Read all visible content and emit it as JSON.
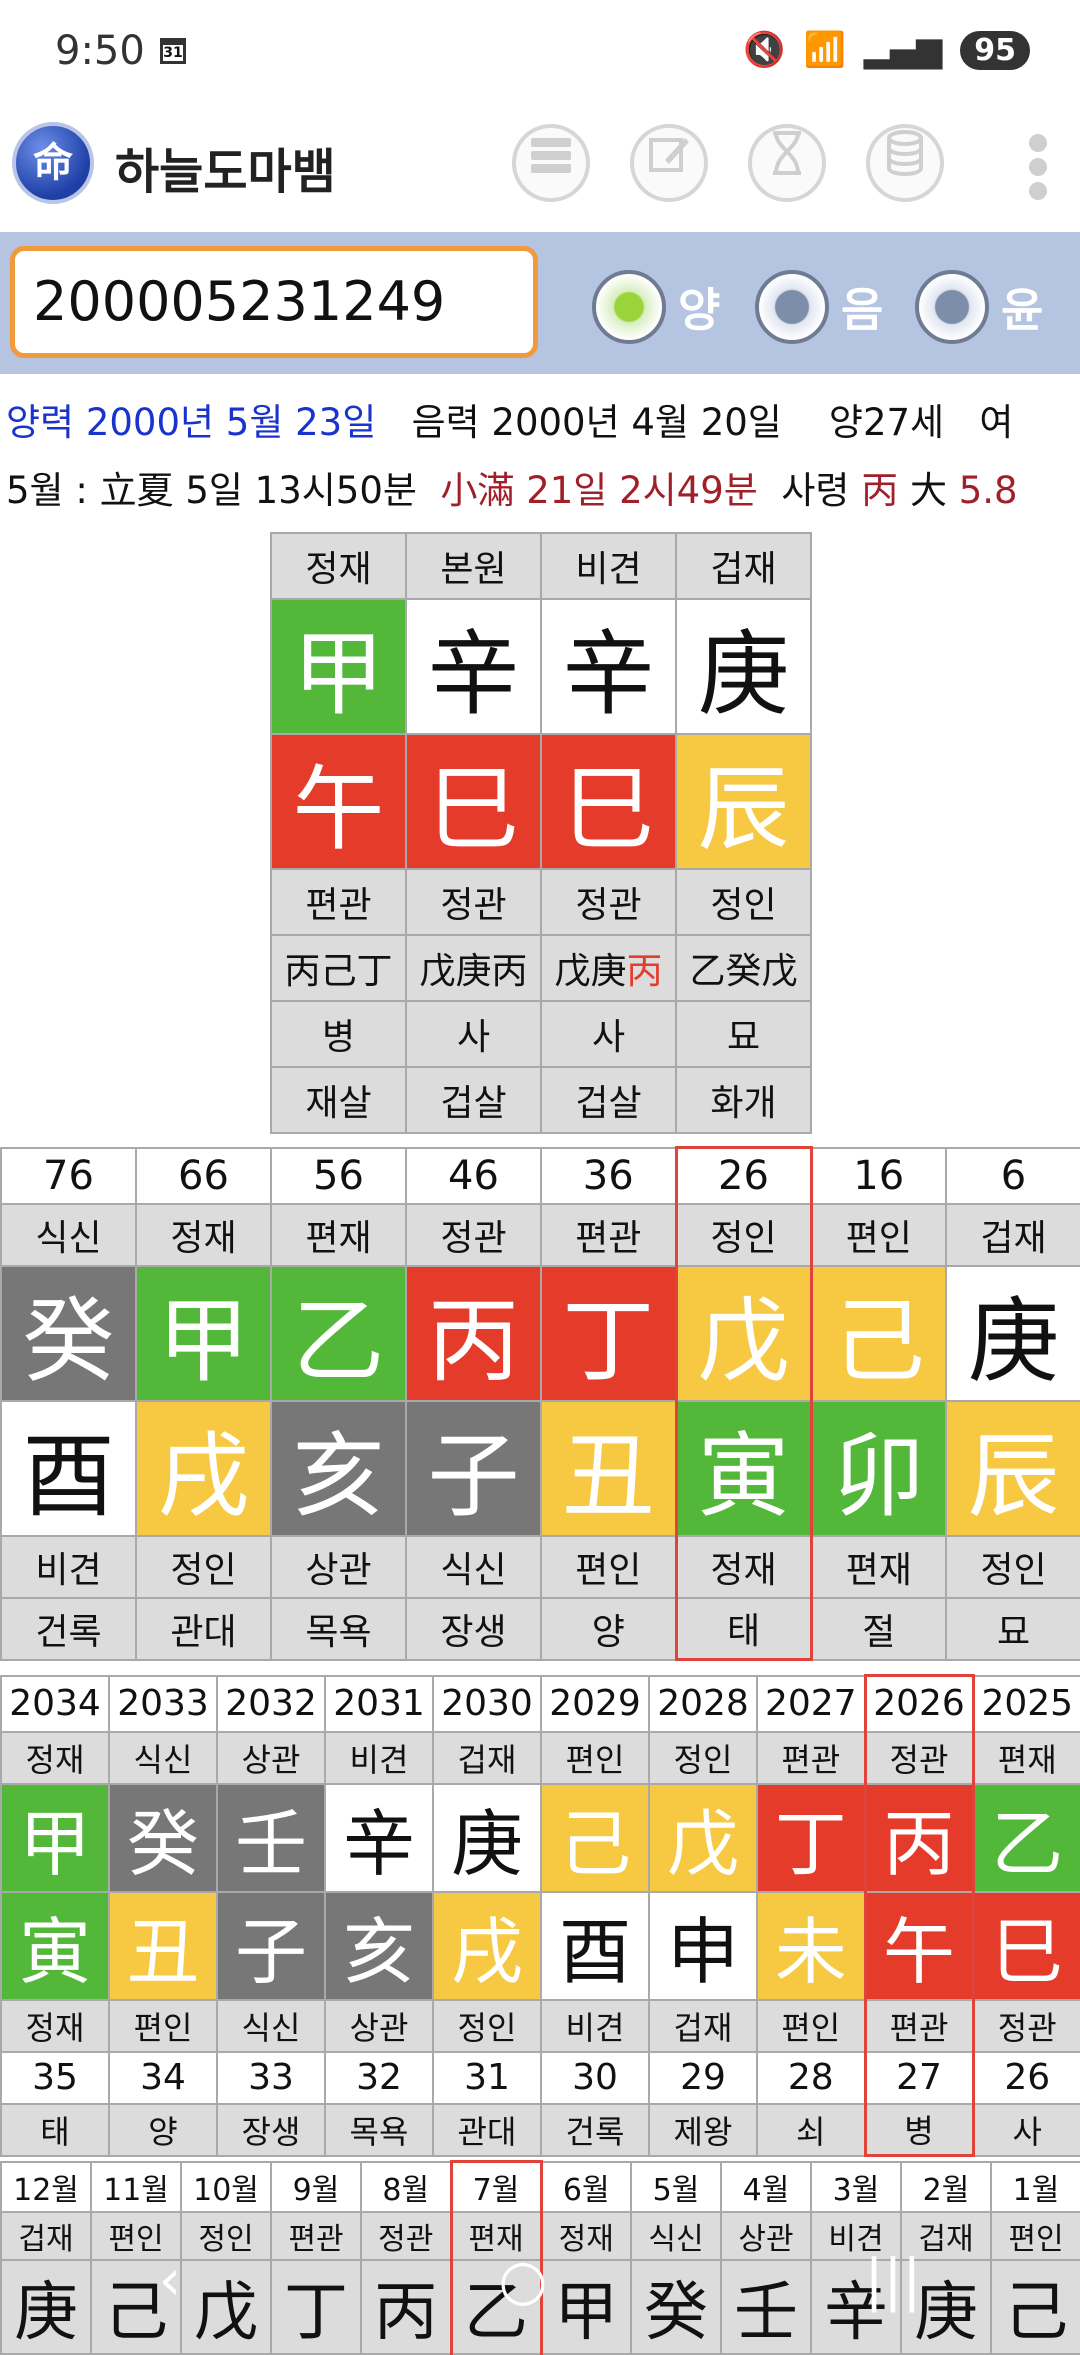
{
  "status": {
    "time": "9:50",
    "calendar_day": "31",
    "signal": "5",
    "battery": "95"
  },
  "app": {
    "title": "하늘도마뱀",
    "logo": "命"
  },
  "input": {
    "value": "200005231249"
  },
  "radios": [
    {
      "label": "양",
      "selected": true
    },
    {
      "label": "음",
      "selected": false
    },
    {
      "label": "윤",
      "selected": false
    }
  ],
  "info": {
    "solar": "양력 2000년 5월 23일",
    "lunar": "음력 2000년 4월 20일",
    "age": "양27세",
    "gender": "여",
    "term_month": "5월 : 立夏 5일 13시50분",
    "term_next": "小滿 21일 2시49분",
    "saryeong_label": "사령",
    "saryeong_char": "丙",
    "daeun_label": "大",
    "daeun_value": "5.8"
  },
  "pillars": {
    "top": [
      "정재",
      "본원",
      "비견",
      "겁재"
    ],
    "stems": [
      {
        "c": "甲",
        "col": "g"
      },
      {
        "c": "辛",
        "col": "w"
      },
      {
        "c": "辛",
        "col": "w"
      },
      {
        "c": "庚",
        "col": "w"
      }
    ],
    "branches": [
      {
        "c": "午",
        "col": "r"
      },
      {
        "c": "巳",
        "col": "r"
      },
      {
        "c": "巳",
        "col": "r"
      },
      {
        "c": "辰",
        "col": "y"
      }
    ],
    "tengods": [
      "편관",
      "정관",
      "정관",
      "정인"
    ],
    "hidden": [
      [
        "丙己丁",
        ""
      ],
      [
        "戊庚丙",
        ""
      ],
      [
        "戊庚",
        "丙"
      ],
      [
        "乙癸戊",
        ""
      ]
    ],
    "stage": [
      "병",
      "사",
      "사",
      "묘"
    ],
    "sinsal": [
      "재살",
      "겁살",
      "겁살",
      "화개"
    ]
  },
  "daeun": {
    "ages": [
      "76",
      "66",
      "56",
      "46",
      "36",
      "26",
      "16",
      "6"
    ],
    "top": [
      "식신",
      "정재",
      "편재",
      "정관",
      "편관",
      "정인",
      "편인",
      "겁재"
    ],
    "stems": [
      {
        "c": "癸",
        "col": "k"
      },
      {
        "c": "甲",
        "col": "g"
      },
      {
        "c": "乙",
        "col": "g"
      },
      {
        "c": "丙",
        "col": "r"
      },
      {
        "c": "丁",
        "col": "r"
      },
      {
        "c": "戊",
        "col": "y"
      },
      {
        "c": "己",
        "col": "y"
      },
      {
        "c": "庚",
        "col": "w"
      }
    ],
    "branches": [
      {
        "c": "酉",
        "col": "w"
      },
      {
        "c": "戌",
        "col": "y"
      },
      {
        "c": "亥",
        "col": "k"
      },
      {
        "c": "子",
        "col": "k"
      },
      {
        "c": "丑",
        "col": "y"
      },
      {
        "c": "寅",
        "col": "g"
      },
      {
        "c": "卯",
        "col": "g"
      },
      {
        "c": "辰",
        "col": "y"
      }
    ],
    "bottom": [
      "비견",
      "정인",
      "상관",
      "식신",
      "편인",
      "정재",
      "편재",
      "정인"
    ],
    "stage": [
      "건록",
      "관대",
      "목욕",
      "장생",
      "양",
      "태",
      "절",
      "묘"
    ],
    "selected_index": 5
  },
  "years": {
    "years": [
      "2034",
      "2033",
      "2032",
      "2031",
      "2030",
      "2029",
      "2028",
      "2027",
      "2026",
      "2025"
    ],
    "top": [
      "정재",
      "식신",
      "상관",
      "비견",
      "겁재",
      "편인",
      "정인",
      "편관",
      "정관",
      "편재"
    ],
    "stems": [
      {
        "c": "甲",
        "col": "g"
      },
      {
        "c": "癸",
        "col": "k"
      },
      {
        "c": "壬",
        "col": "k"
      },
      {
        "c": "辛",
        "col": "w"
      },
      {
        "c": "庚",
        "col": "w"
      },
      {
        "c": "己",
        "col": "y"
      },
      {
        "c": "戊",
        "col": "y"
      },
      {
        "c": "丁",
        "col": "r"
      },
      {
        "c": "丙",
        "col": "r"
      },
      {
        "c": "乙",
        "col": "g"
      }
    ],
    "branches": [
      {
        "c": "寅",
        "col": "g"
      },
      {
        "c": "丑",
        "col": "y"
      },
      {
        "c": "子",
        "col": "k"
      },
      {
        "c": "亥",
        "col": "k"
      },
      {
        "c": "戌",
        "col": "y"
      },
      {
        "c": "酉",
        "col": "w"
      },
      {
        "c": "申",
        "col": "w"
      },
      {
        "c": "未",
        "col": "y"
      },
      {
        "c": "午",
        "col": "r"
      },
      {
        "c": "巳",
        "col": "r"
      }
    ],
    "bottom": [
      "정재",
      "편인",
      "식신",
      "상관",
      "정인",
      "비견",
      "겁재",
      "편인",
      "편관",
      "정관"
    ],
    "ages": [
      "35",
      "34",
      "33",
      "32",
      "31",
      "30",
      "29",
      "28",
      "27",
      "26"
    ],
    "stage": [
      "태",
      "양",
      "장생",
      "목욕",
      "관대",
      "건록",
      "제왕",
      "쇠",
      "병",
      "사"
    ],
    "selected_index": 8
  },
  "months": {
    "months": [
      "12월",
      "11월",
      "10월",
      "9월",
      "8월",
      "7월",
      "6월",
      "5월",
      "4월",
      "3월",
      "2월",
      "1월"
    ],
    "top": [
      "겁재",
      "편인",
      "정인",
      "편관",
      "정관",
      "편재",
      "정재",
      "식신",
      "상관",
      "비견",
      "겁재",
      "편인"
    ],
    "stems": [
      "庚",
      "己",
      "戊",
      "丁",
      "丙",
      "乙",
      "甲",
      "癸",
      "壬",
      "辛",
      "庚",
      "己"
    ],
    "selected_index": 5
  },
  "nav": {
    "back": "‹",
    "home": "○",
    "recents": "|||"
  }
}
